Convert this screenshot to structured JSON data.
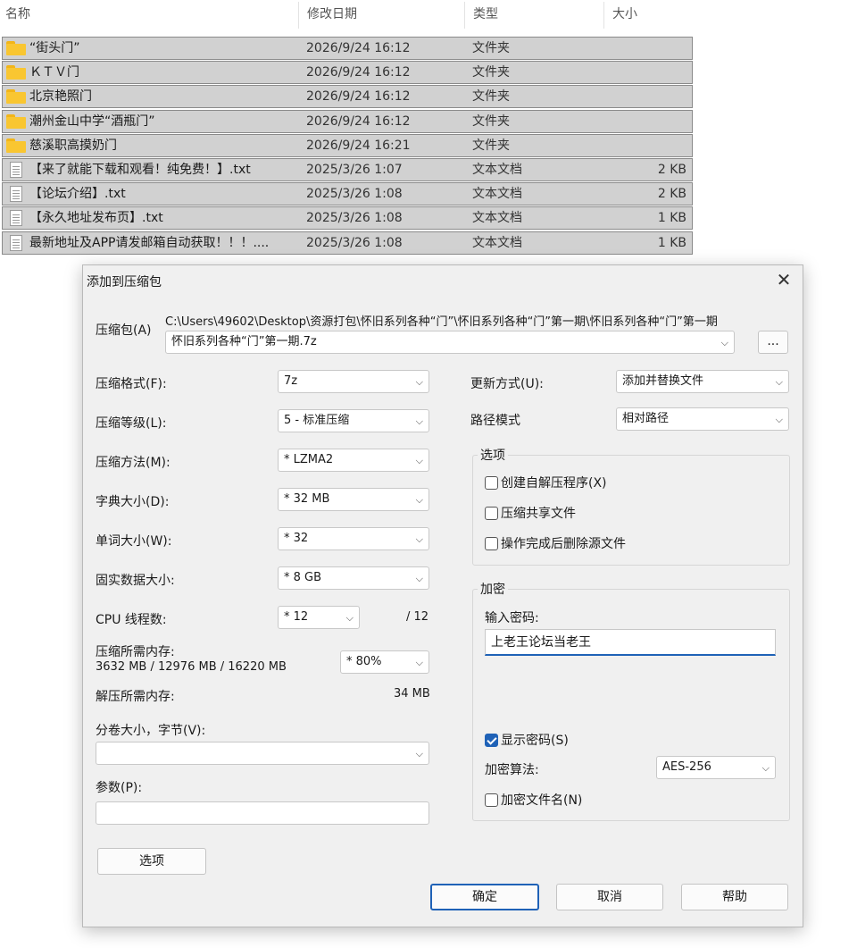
{
  "explorer": {
    "headers": {
      "name": "名称",
      "date": "修改日期",
      "type": "类型",
      "size": "大小"
    },
    "rows": [
      {
        "name": "“街头门”",
        "date": "2026/9/24 16:12",
        "type": "文件夹",
        "size": "",
        "icon": "folder-icon"
      },
      {
        "name": "ＫＴＶ门",
        "date": "2026/9/24 16:12",
        "type": "文件夹",
        "size": "",
        "icon": "folder-icon"
      },
      {
        "name": "北京艳照门",
        "date": "2026/9/24 16:12",
        "type": "文件夹",
        "size": "",
        "icon": "folder-icon"
      },
      {
        "name": "潮州金山中学“酒瓶门”",
        "date": "2026/9/24 16:12",
        "type": "文件夹",
        "size": "",
        "icon": "folder-icon"
      },
      {
        "name": "慈溪职高摸奶门",
        "date": "2026/9/24 16:21",
        "type": "文件夹",
        "size": "",
        "icon": "folder-icon"
      },
      {
        "name": "【来了就能下载和观看！纯免费！】.txt",
        "date": "2025/3/26 1:07",
        "type": "文本文档",
        "size": "2 KB",
        "icon": "text-file-icon"
      },
      {
        "name": "【论坛介绍】.txt",
        "date": "2025/3/26 1:08",
        "type": "文本文档",
        "size": "2 KB",
        "icon": "text-file-icon"
      },
      {
        "name": "【永久地址发布页】.txt",
        "date": "2025/3/26 1:08",
        "type": "文本文档",
        "size": "1 KB",
        "icon": "text-file-icon"
      },
      {
        "name": "最新地址及APP请发邮箱自动获取！！！....",
        "date": "2025/3/26 1:08",
        "type": "文本文档",
        "size": "1 KB",
        "icon": "text-file-icon"
      }
    ]
  },
  "dialog": {
    "title": "添加到压缩包",
    "close": "✕",
    "archive_label": "压缩包(A)",
    "archive_path": "C:\\Users\\49602\\Desktop\\资源打包\\怀旧系列各种“门”\\怀旧系列各种“门”第一期\\怀旧系列各种“门”第一期",
    "archive_name": "怀旧系列各种“门”第一期.7z",
    "browse_label": "...",
    "format_label": "压缩格式(F):",
    "format_value": "7z",
    "level_label": "压缩等级(L):",
    "level_value": "5 - 标准压缩",
    "method_label": "压缩方法(M):",
    "method_value": "* LZMA2",
    "dict_label": "字典大小(D):",
    "dict_value": "* 32 MB",
    "word_label": "单词大小(W):",
    "word_value": "* 32",
    "solid_label": "固实数据大小:",
    "solid_value": "* 8 GB",
    "cpu_label": "CPU 线程数:",
    "cpu_value": "* 12",
    "cpu_total": "/ 12",
    "mem_comp_label": "压缩所需内存:",
    "mem_comp_value": "3632 MB / 12976 MB / 16220 MB",
    "mem_pct_value": "* 80%",
    "mem_decomp_label": "解压所需内存:",
    "mem_decomp_value": "34 MB",
    "split_label": "分卷大小，字节(V):",
    "split_value": "",
    "params_label": "参数(P):",
    "params_value": "",
    "options_btn": "选项",
    "update_label": "更新方式(U):",
    "update_value": "添加并替换文件",
    "path_label": "路径模式",
    "path_value": "相对路径",
    "options_group": "选项",
    "opt_sfx": "创建自解压程序(X)",
    "opt_shared": "压缩共享文件",
    "opt_delete": "操作完成后删除源文件",
    "encrypt_group": "加密",
    "pwd_label": "输入密码:",
    "pwd_value": "上老王论坛当老王",
    "show_pwd": "显示密码(S)",
    "enc_method_label": "加密算法:",
    "enc_method_value": "AES-256",
    "enc_names": "加密文件名(N)",
    "ok": "确定",
    "cancel": "取消",
    "help": "帮助"
  },
  "colors": {
    "accent": "#1f62b7",
    "selection": "#d1d1d1",
    "folder": "#f9c631"
  }
}
